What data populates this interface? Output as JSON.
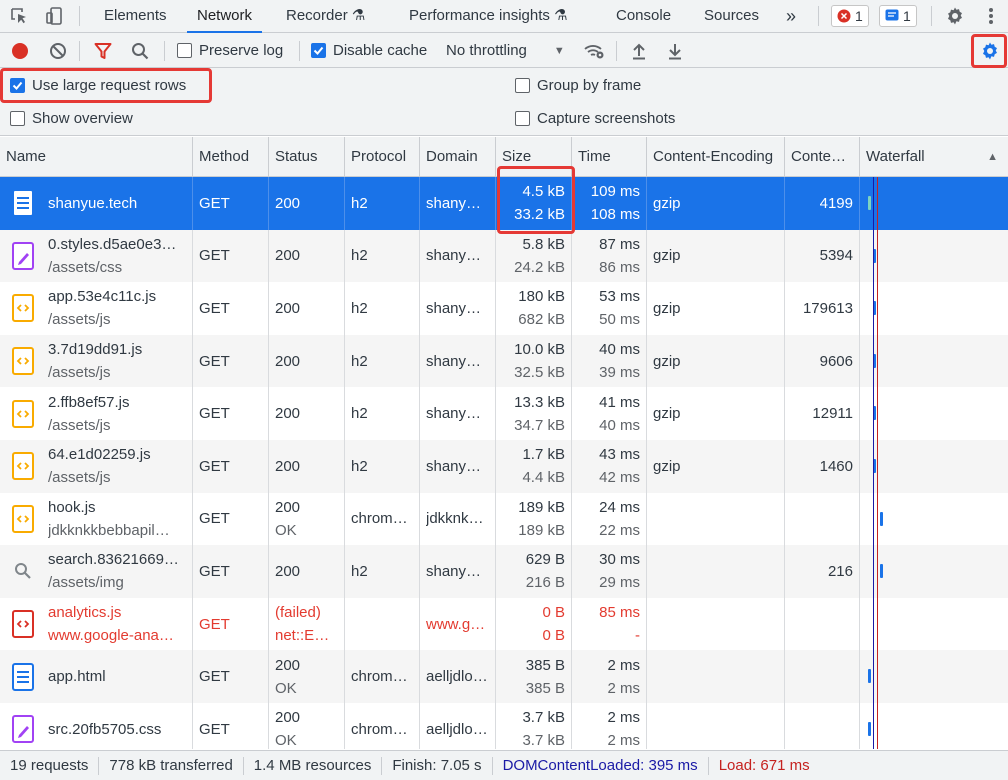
{
  "tabs": [
    "Elements",
    "Network",
    "Recorder",
    "Performance insights",
    "Console",
    "Sources"
  ],
  "more_tabs": "»",
  "errors_count": "1",
  "messages_count": "1",
  "toolbar": {
    "preserve_log": "Preserve log",
    "disable_cache": "Disable cache",
    "throttling": "No throttling"
  },
  "settings": {
    "large_rows": "Use large request rows",
    "show_overview": "Show overview",
    "group_by_frame": "Group by frame",
    "capture_screenshots": "Capture screenshots"
  },
  "columns": [
    "Name",
    "Method",
    "Status",
    "Protocol",
    "Domain",
    "Size",
    "Time",
    "Content-Encoding",
    "Conte…",
    "Waterfall"
  ],
  "rows": [
    {
      "name": "shanyue.tech",
      "path": "",
      "type": "doc",
      "method": "GET",
      "status": "200",
      "status2": "",
      "protocol": "h2",
      "domain": "shany…",
      "size1": "4.5 kB",
      "size2": "33.2 kB",
      "time1": "109 ms",
      "time2": "108 ms",
      "enc": "gzip",
      "len": "4199"
    },
    {
      "name": "0.styles.d5ae0e3…",
      "path": "/assets/css",
      "type": "css",
      "method": "GET",
      "status": "200",
      "status2": "",
      "protocol": "h2",
      "domain": "shany…",
      "size1": "5.8 kB",
      "size2": "24.2 kB",
      "time1": "87 ms",
      "time2": "86 ms",
      "enc": "gzip",
      "len": "5394"
    },
    {
      "name": "app.53e4c11c.js",
      "path": "/assets/js",
      "type": "js",
      "method": "GET",
      "status": "200",
      "status2": "",
      "protocol": "h2",
      "domain": "shany…",
      "size1": "180 kB",
      "size2": "682 kB",
      "time1": "53 ms",
      "time2": "50 ms",
      "enc": "gzip",
      "len": "179613"
    },
    {
      "name": "3.7d19dd91.js",
      "path": "/assets/js",
      "type": "js",
      "method": "GET",
      "status": "200",
      "status2": "",
      "protocol": "h2",
      "domain": "shany…",
      "size1": "10.0 kB",
      "size2": "32.5 kB",
      "time1": "40 ms",
      "time2": "39 ms",
      "enc": "gzip",
      "len": "9606"
    },
    {
      "name": "2.ffb8ef57.js",
      "path": "/assets/js",
      "type": "js",
      "method": "GET",
      "status": "200",
      "status2": "",
      "protocol": "h2",
      "domain": "shany…",
      "size1": "13.3 kB",
      "size2": "34.7 kB",
      "time1": "41 ms",
      "time2": "40 ms",
      "enc": "gzip",
      "len": "12911"
    },
    {
      "name": "64.e1d02259.js",
      "path": "/assets/js",
      "type": "js",
      "method": "GET",
      "status": "200",
      "status2": "",
      "protocol": "h2",
      "domain": "shany…",
      "size1": "1.7 kB",
      "size2": "4.4 kB",
      "time1": "43 ms",
      "time2": "42 ms",
      "enc": "gzip",
      "len": "1460"
    },
    {
      "name": "hook.js",
      "path": "jdkknkkbebbapil…",
      "type": "js",
      "method": "GET",
      "status": "200",
      "status2": "OK",
      "protocol": "chrom…",
      "domain": "jdkknk…",
      "size1": "189 kB",
      "size2": "189 kB",
      "time1": "24 ms",
      "time2": "22 ms",
      "enc": "",
      "len": ""
    },
    {
      "name": "search.83621669…",
      "path": "/assets/img",
      "type": "img",
      "method": "GET",
      "status": "200",
      "status2": "",
      "protocol": "h2",
      "domain": "shany…",
      "size1": "629 B",
      "size2": "216 B",
      "time1": "30 ms",
      "time2": "29 ms",
      "enc": "",
      "len": "216"
    },
    {
      "name": "analytics.js",
      "path": "www.google-ana…",
      "type": "jsfail",
      "method": "GET",
      "status": "(failed)",
      "status2": "net::E…",
      "protocol": "",
      "domain": "www.g…",
      "size1": "0 B",
      "size2": "0 B",
      "time1": "85 ms",
      "time2": "-",
      "enc": "",
      "len": ""
    },
    {
      "name": "app.html",
      "path": "",
      "type": "doc",
      "method": "GET",
      "status": "200",
      "status2": "OK",
      "protocol": "chrom…",
      "domain": "aelljdlo…",
      "size1": "385 B",
      "size2": "385 B",
      "time1": "2 ms",
      "time2": "2 ms",
      "enc": "",
      "len": ""
    },
    {
      "name": "src.20fb5705.css",
      "path": "",
      "type": "css",
      "method": "GET",
      "status": "200",
      "status2": "OK",
      "protocol": "chrom…",
      "domain": "aelljdlo…",
      "size1": "3.7 kB",
      "size2": "3.7 kB",
      "time1": "2 ms",
      "time2": "2 ms",
      "enc": "",
      "len": ""
    }
  ],
  "status_bar": {
    "requests": "19 requests",
    "transferred": "778 kB transferred",
    "resources": "1.4 MB resources",
    "finish": "Finish: 7.05 s",
    "dcl": "DOMContentLoaded: 395 ms",
    "load": "Load: 671 ms"
  },
  "colors": {
    "accent": "#1a73e8",
    "error": "#d93025",
    "dcl": "#1a1aa6",
    "load": "#c5221f",
    "highlight": "#e53935"
  }
}
